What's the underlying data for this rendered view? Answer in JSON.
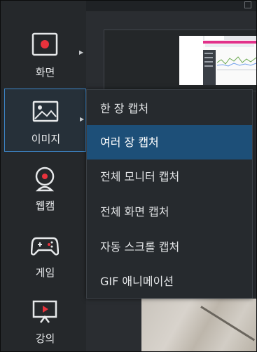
{
  "sidebar": {
    "items": [
      {
        "label": "화면",
        "icon": "screen-record-icon"
      },
      {
        "label": "이미지",
        "icon": "image-icon"
      },
      {
        "label": "웹캠",
        "icon": "webcam-icon"
      },
      {
        "label": "게임",
        "icon": "gamepad-icon"
      },
      {
        "label": "강의",
        "icon": "lecture-icon"
      }
    ],
    "selected": "이미지"
  },
  "menu": {
    "items": [
      {
        "label": "한 장 캡처"
      },
      {
        "label": "여러 장 캡처"
      },
      {
        "label": "전체 모니터 캡처"
      },
      {
        "label": "전체 화면 캡처"
      },
      {
        "label": "자동 스크롤 캡처"
      },
      {
        "label": "GIF 애니메이션"
      }
    ],
    "highlighted": "여러 장 캡처"
  },
  "colors": {
    "accent": "#1d4f78",
    "selection_border": "#3d85c6",
    "record_dot": "#e8323c"
  }
}
